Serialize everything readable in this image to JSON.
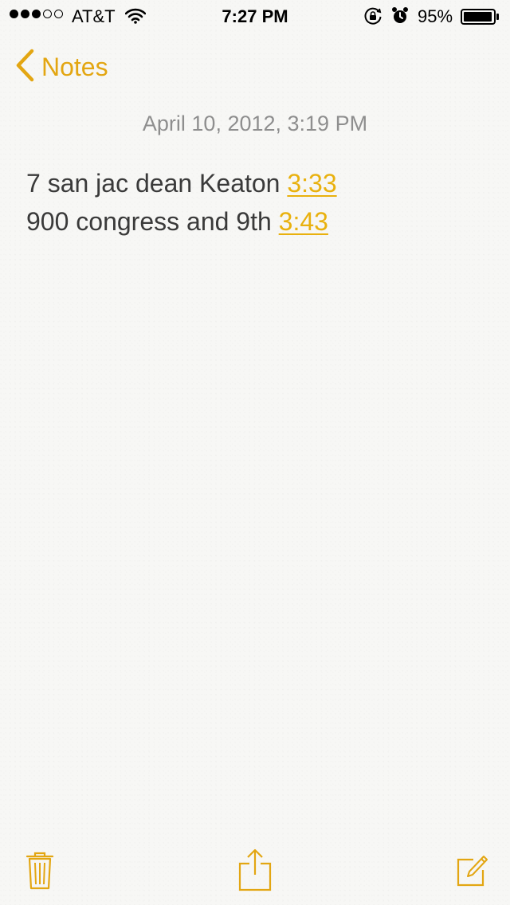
{
  "status_bar": {
    "carrier": "AT&T",
    "time": "7:27 PM",
    "battery_percent": "95%",
    "signal_bars_filled": 3,
    "signal_bars_total": 5,
    "icons": [
      "wifi-icon",
      "rotation-lock-icon",
      "alarm-icon",
      "battery-icon"
    ]
  },
  "nav": {
    "back_label": "Notes"
  },
  "note": {
    "date": "April 10, 2012, 3:19 PM",
    "lines": [
      {
        "text": "7 san jac dean Keaton ",
        "link": "3:33"
      },
      {
        "text": "900 congress and 9th ",
        "link": "3:43"
      }
    ]
  },
  "toolbar": {
    "items": [
      "trash-icon",
      "share-icon",
      "compose-icon"
    ]
  },
  "colors": {
    "accent": "#e3a612",
    "link": "#e9b10e",
    "date": "#8e8e8e",
    "text": "#3a3a3a",
    "background": "#f7f7f5"
  }
}
